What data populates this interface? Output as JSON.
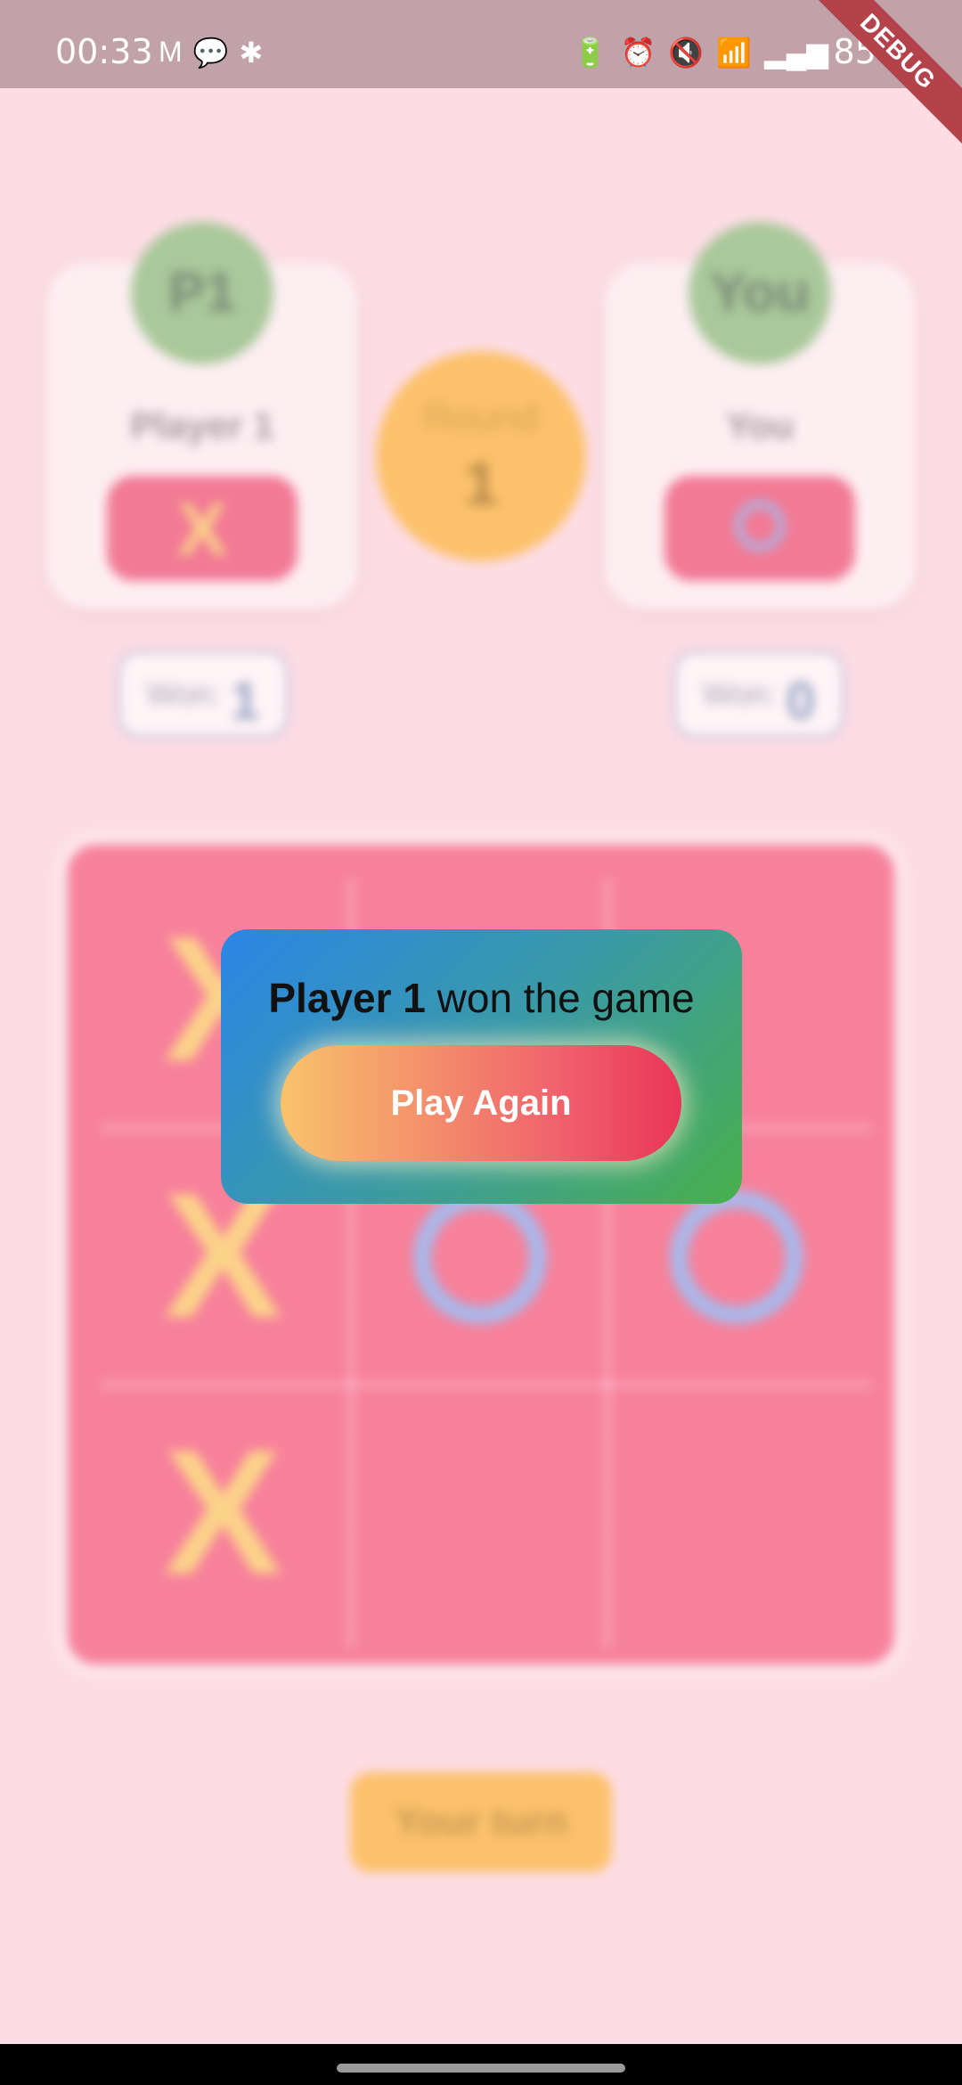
{
  "status_bar": {
    "time": "00:33",
    "left_icons": [
      "M",
      "💬",
      "✱"
    ],
    "right_icons": [
      "🔋",
      "⏰",
      "🔇",
      "📶",
      "▂▄▆"
    ],
    "battery": "85%"
  },
  "debug_ribbon": "DEBUG",
  "players": {
    "left": {
      "avatar": "P1",
      "name": "Player 1",
      "mark": "X",
      "won_label": "Won:",
      "won_count": "1"
    },
    "right": {
      "avatar": "You",
      "name": "You",
      "mark": "O",
      "won_label": "Won:",
      "won_count": "0"
    }
  },
  "round": {
    "label": "Round",
    "number": "1"
  },
  "board": {
    "cells": [
      "X",
      "",
      "",
      "X",
      "O",
      "O",
      "X",
      "",
      ""
    ]
  },
  "turn_label": "Your turn",
  "dialog": {
    "winner": "Player 1",
    "message_suffix": " won the game",
    "button_label": "Play Again"
  },
  "colors": {
    "background": "#fddde5",
    "status_bar": "#c0a2a8",
    "board": "#f7819b",
    "x_mark": "#fbd28a",
    "o_mark": "#a9b8ea",
    "round": "#fcc16b"
  }
}
